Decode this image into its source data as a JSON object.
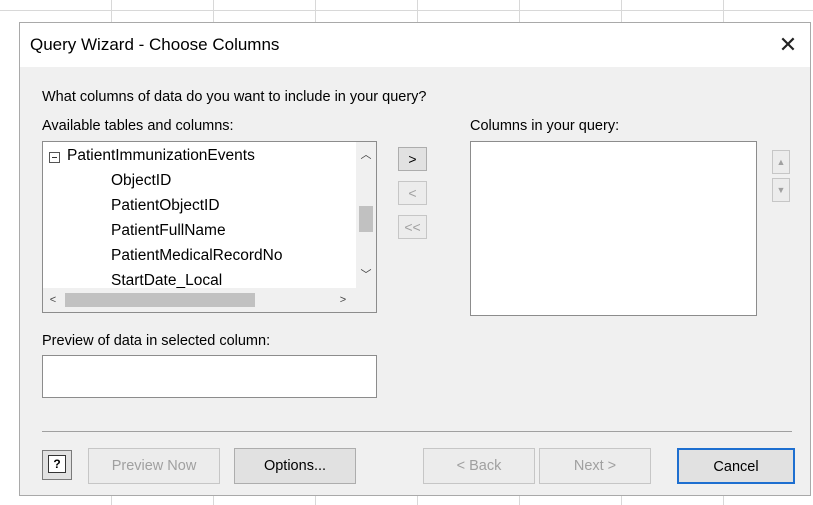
{
  "dialog": {
    "title": "Query Wizard - Choose Columns",
    "close_icon": "close-icon",
    "question": "What columns of data do you want to include in your query?",
    "available_label": "Available tables and columns:",
    "columns_label": "Columns in your query:",
    "preview_label": "Preview of data in selected column:",
    "preview_value": ""
  },
  "tables": {
    "table_name": "PatientImmunizationEvents",
    "columns": [
      "ObjectID",
      "PatientObjectID",
      "PatientFullName",
      "PatientMedicalRecordNo",
      "StartDate_Local"
    ]
  },
  "move_buttons": {
    "add": ">",
    "remove": "<",
    "remove_all": "<<"
  },
  "footer": {
    "preview_now": "Preview Now",
    "options": "Options...",
    "back": "< Back",
    "next": "Next >",
    "cancel": "Cancel"
  },
  "colors": {
    "dialog_bg": "#f0f0f0",
    "disabled_text": "#a0a0a0"
  }
}
